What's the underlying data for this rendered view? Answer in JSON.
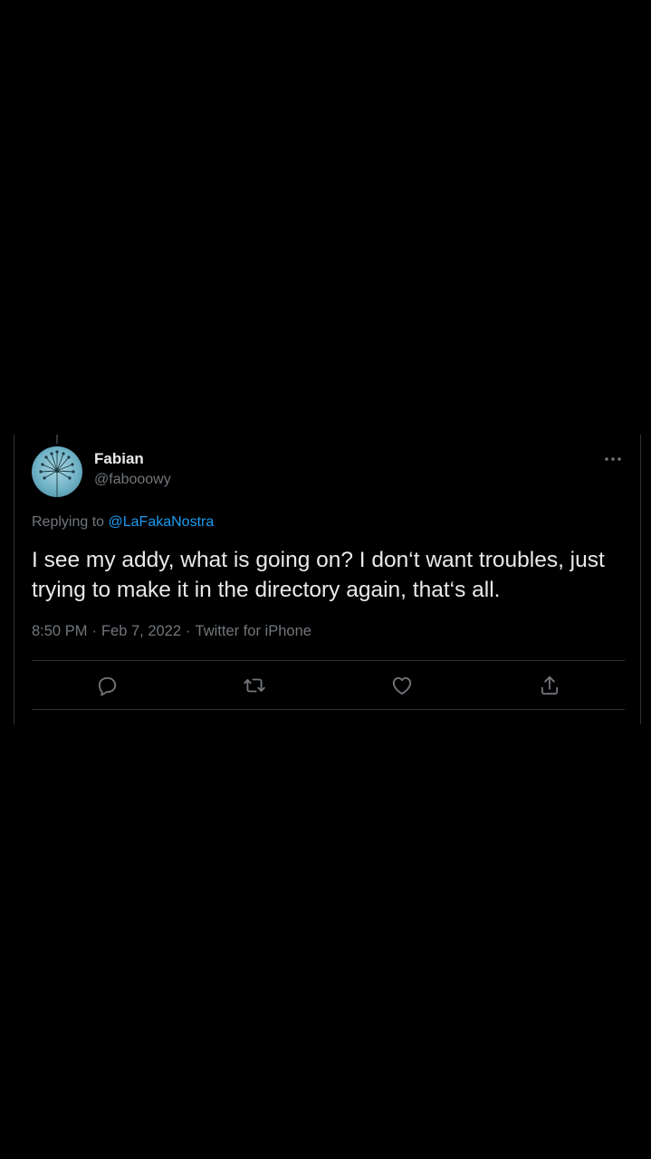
{
  "tweet": {
    "author": {
      "display_name": "Fabian",
      "handle": "@fabooowy",
      "avatar_icon": "dandelion-avatar"
    },
    "reply": {
      "prefix": "Replying to",
      "mention": "@LaFakaNostra"
    },
    "text": "I see my addy, what is going on? I don‘t want troubles, just trying to make it in the directory again, that‘s all.",
    "meta": {
      "time": "8:50 PM",
      "separator": "·",
      "date": "Feb 7, 2022",
      "source": "Twitter for iPhone"
    },
    "actions": [
      {
        "icon": "reply-icon"
      },
      {
        "icon": "retweet-icon"
      },
      {
        "icon": "like-icon"
      },
      {
        "icon": "share-icon"
      }
    ],
    "more_icon": "more-icon"
  },
  "colors": {
    "background": "#000000",
    "text": "#e7e9ea",
    "muted": "#71767b",
    "link": "#1d9bf0",
    "border": "#2f3336"
  }
}
